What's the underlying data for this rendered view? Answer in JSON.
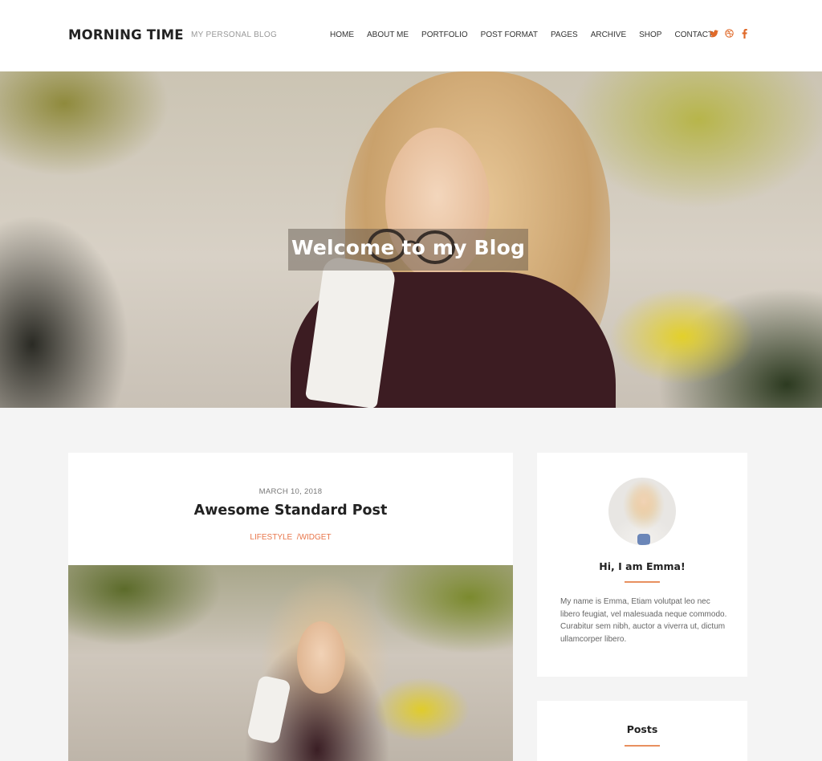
{
  "header": {
    "site_title": "MORNING TIME",
    "tagline": "MY PERSONAL BLOG",
    "nav": [
      {
        "label": "HOME"
      },
      {
        "label": "ABOUT ME"
      },
      {
        "label": "PORTFOLIO"
      },
      {
        "label": "POST FORMAT"
      },
      {
        "label": "PAGES"
      },
      {
        "label": "ARCHIVE"
      },
      {
        "label": "SHOP"
      },
      {
        "label": "CONTACT"
      }
    ],
    "social": [
      {
        "icon": "twitter-icon"
      },
      {
        "icon": "dribbble-icon"
      },
      {
        "icon": "facebook-icon"
      }
    ],
    "accent_color": "#e06a2a"
  },
  "hero": {
    "title": "Welcome to my Blog"
  },
  "post": {
    "date": "MARCH 10, 2018",
    "title": "Awesome Standard Post",
    "categories": [
      "LIFESTYLE",
      "/WIDGET"
    ]
  },
  "sidebar": {
    "about": {
      "title": "Hi, I am Emma!",
      "text": "My name is Emma, Etiam volutpat leo nec libero feugiat, vel malesuada neque commodo. Curabitur sem nibh, auctor a viverra ut, dictum ullamcorper libero."
    },
    "posts": {
      "title": "Posts"
    }
  }
}
